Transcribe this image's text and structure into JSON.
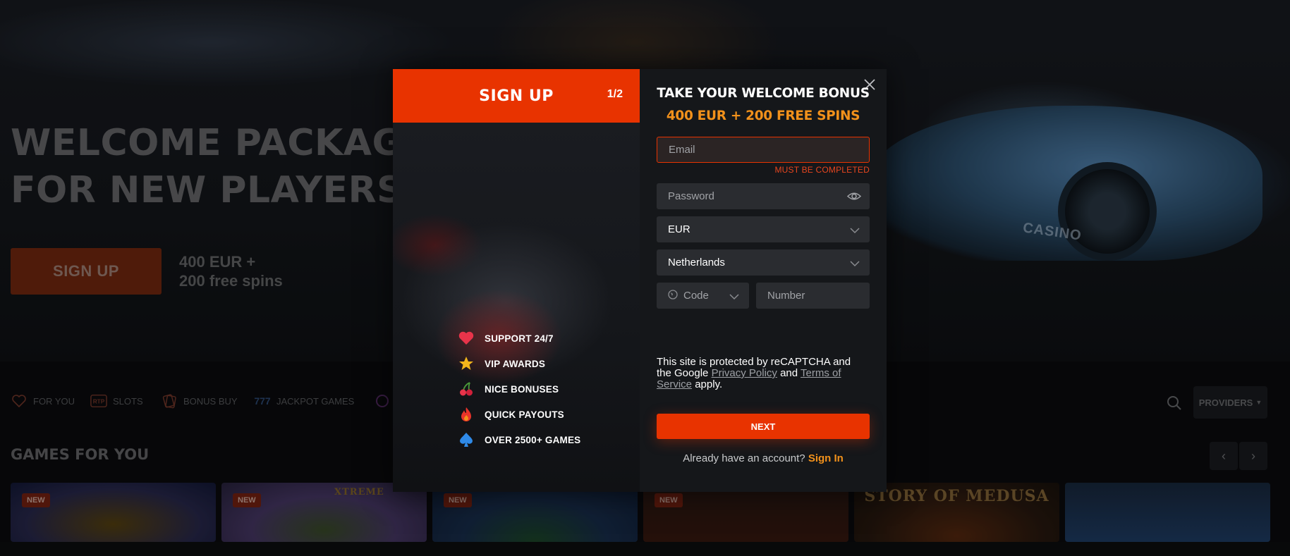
{
  "hero": {
    "title_line1": "WELCOME PACKAGE",
    "title_line2": "FOR NEW PLAYERS",
    "signup_label": "SIGN UP",
    "bonus_line1": "400 EUR +",
    "bonus_line2": "200 free spins",
    "car_text": "CASINO"
  },
  "categories": [
    {
      "label": "FOR YOU",
      "icon": "heart-outline-icon"
    },
    {
      "label": "SLOTS",
      "icon": "rtp-icon"
    },
    {
      "label": "BONUS BUY",
      "icon": "cards-icon"
    },
    {
      "label": "JACKPOT GAMES",
      "icon": "777-icon"
    }
  ],
  "providers_label": "PROVIDERS",
  "games": {
    "title": "GAMES FOR YOU",
    "tiles": [
      {
        "badge": "NEW",
        "logo": ""
      },
      {
        "badge": "NEW",
        "logo": "XTREME"
      },
      {
        "badge": "NEW",
        "logo": ""
      },
      {
        "badge": "NEW",
        "logo": ""
      },
      {
        "badge": "",
        "logo": "STORY OF MEDUSA"
      },
      {
        "badge": "",
        "logo": ""
      }
    ]
  },
  "modal": {
    "header": "SIGN UP",
    "step": "1/2",
    "perks": [
      {
        "label": "SUPPORT 24/7",
        "icon": "heart-icon"
      },
      {
        "label": "VIP AWARDS",
        "icon": "star-icon"
      },
      {
        "label": "NICE BONUSES",
        "icon": "cherry-icon"
      },
      {
        "label": "QUICK PAYOUTS",
        "icon": "flame-icon"
      },
      {
        "label": "OVER 2500+ GAMES",
        "icon": "spade-icon"
      }
    ],
    "welcome_title": "TAKE YOUR WELCOME BONUS",
    "welcome_offer": "400 EUR + 200 FREE SPINS",
    "email_placeholder": "Email",
    "email_error": "MUST BE COMPLETED",
    "password_placeholder": "Password",
    "currency": "EUR",
    "country": "Netherlands",
    "code_placeholder": "Code",
    "number_placeholder": "Number",
    "recaptcha_prefix": "This site is protected by reCAPTCHA and the Google",
    "privacy_link": "Privacy Policy",
    "and_text": "and",
    "terms_link": "Terms of Service",
    "apply_text": "apply.",
    "next_label": "NEXT",
    "have_account": "Already have an account?",
    "sign_in": "Sign In"
  },
  "colors": {
    "accent": "#e83300",
    "offer": "#f2911b",
    "panel": "#15171a",
    "field": "#2a2c30"
  }
}
